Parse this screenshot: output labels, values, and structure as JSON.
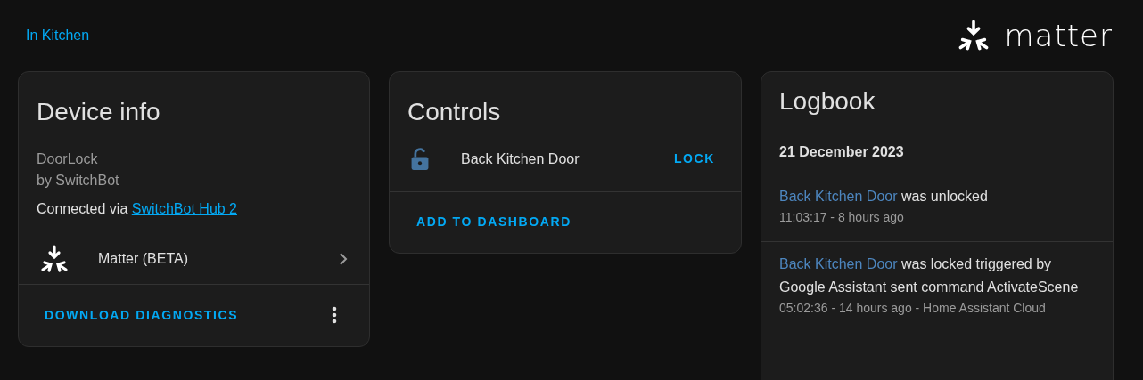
{
  "breadcrumb": {
    "area_link": "In Kitchen"
  },
  "brand": {
    "wordmark": "matter"
  },
  "device_info": {
    "title": "Device info",
    "model": "DoorLock",
    "manufacturer": "by SwitchBot",
    "connected_prefix": "Connected via",
    "connected_link": "SwitchBot Hub 2",
    "integration": {
      "name": "Matter (BETA)"
    },
    "actions": {
      "download": "DOWNLOAD DIAGNOSTICS"
    }
  },
  "controls": {
    "title": "Controls",
    "entities": [
      {
        "name": "Back Kitchen Door",
        "locked": false,
        "action": "LOCK"
      }
    ],
    "add_button": "ADD TO DASHBOARD"
  },
  "logbook": {
    "title": "Logbook",
    "date": "21 December 2023",
    "entries": [
      {
        "entity": "Back Kitchen Door",
        "message": "was unlocked",
        "meta": "11:03:17 - 8 hours ago"
      },
      {
        "entity": "Back Kitchen Door",
        "message": "was locked triggered by Google Assistant sent command ActivateScene",
        "meta": "05:02:36 - 14 hours ago - Home Assistant Cloud"
      }
    ]
  }
}
